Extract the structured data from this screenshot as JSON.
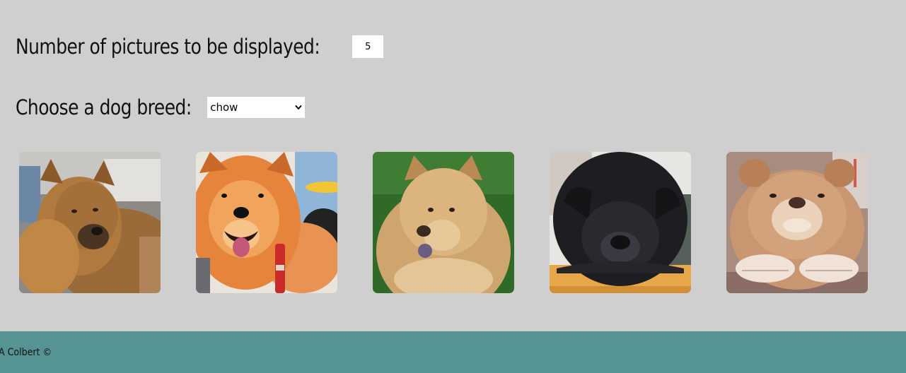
{
  "controls": {
    "count_label": "Number of pictures to be displayed:",
    "count_value": "5",
    "breed_label": "Choose a dog breed:",
    "breed_selected": "chow"
  },
  "gallery": {
    "images": [
      {
        "alt": "chow dog photo 1",
        "fur": "#a86b32"
      },
      {
        "alt": "chow dog photo 2",
        "fur": "#e08a3e"
      },
      {
        "alt": "chow dog photo 3",
        "fur": "#d6ad78"
      },
      {
        "alt": "chow dog photo 4",
        "fur": "#1f1f22"
      },
      {
        "alt": "chow dog photo 5",
        "fur": "#c99672"
      }
    ]
  },
  "footer": {
    "text": "A Colbert ©"
  },
  "colors": {
    "background": "#cfcfcf",
    "footer_bg": "#559493"
  }
}
